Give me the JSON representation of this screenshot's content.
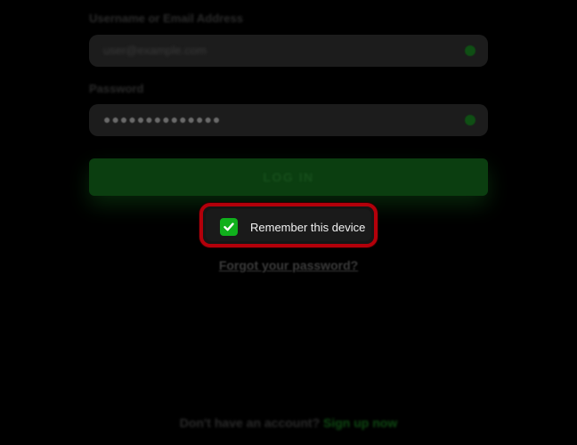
{
  "form": {
    "username_label": "Username or Email Address",
    "username_value": "user@example.com",
    "password_label": "Password",
    "password_value": "●●●●●●●●●●●●●●",
    "login_label": "LOG IN",
    "remember_label": "Remember this device",
    "remember_checked": true,
    "forgot_label": "Forgot your password?"
  },
  "footer": {
    "no_account_text": "Don't have an account?",
    "signup_label": "Sign up now"
  },
  "colors": {
    "accent_green": "#10b01c",
    "highlight_red": "#b3000a",
    "background": "#000000"
  },
  "icons": {
    "field_status": "status-dot-icon",
    "checkbox": "checkmark-icon"
  }
}
